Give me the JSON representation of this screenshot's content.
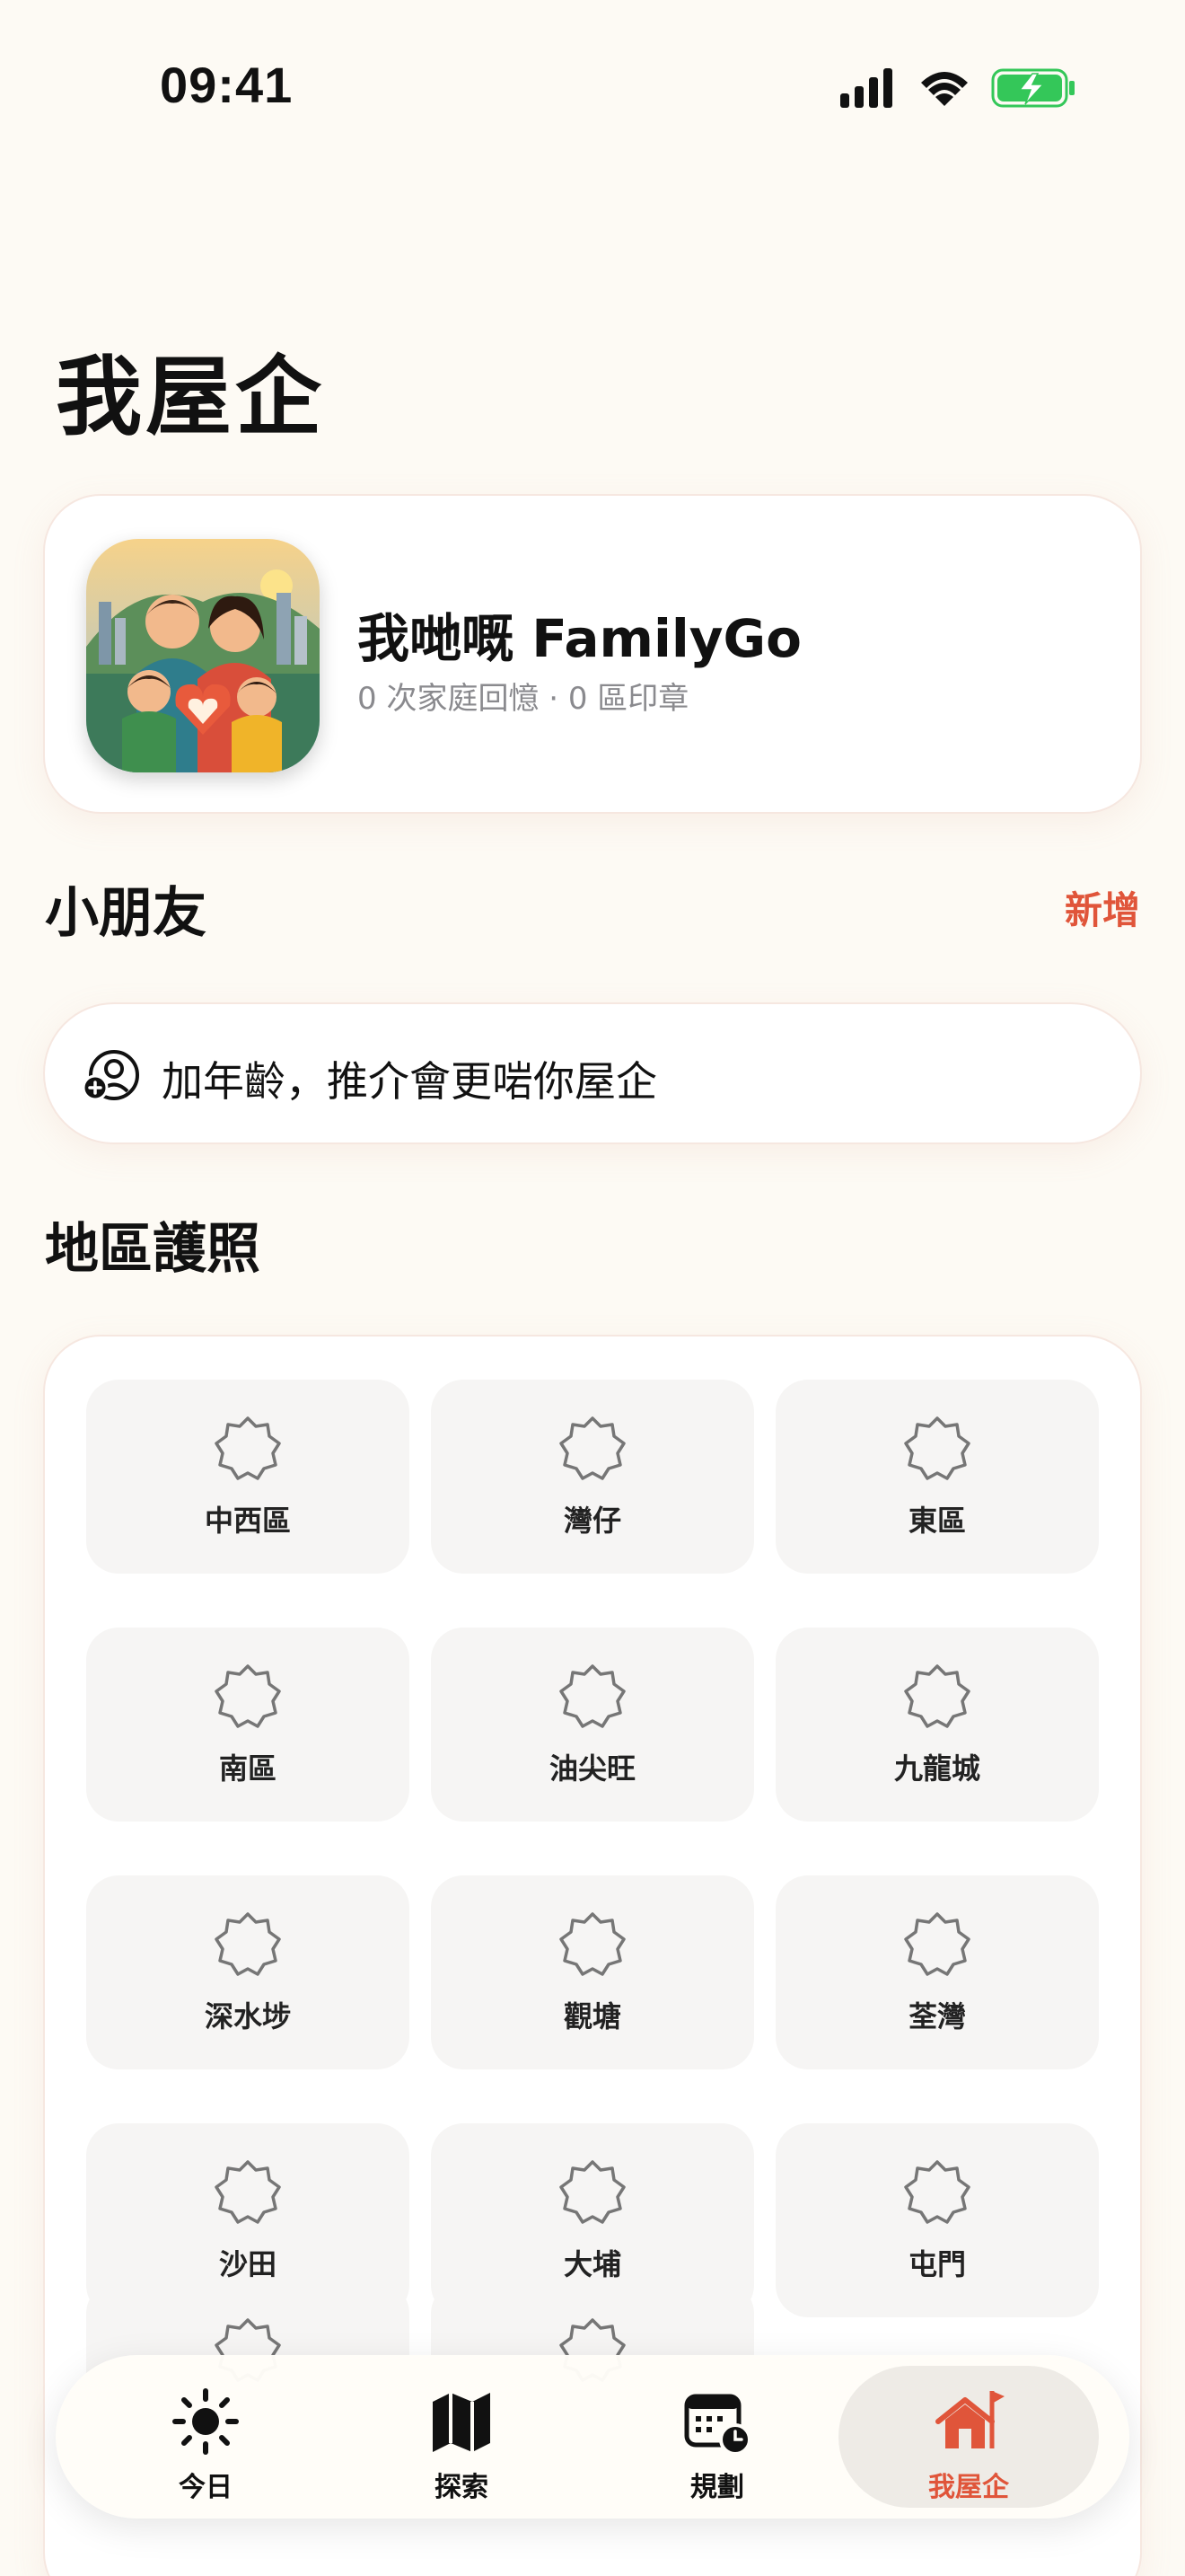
{
  "status_bar": {
    "time": "09:41",
    "icons": [
      "cellular-icon",
      "wifi-icon",
      "battery-charging-icon"
    ],
    "battery_color": "#34C759"
  },
  "page": {
    "title": "我屋企"
  },
  "profile": {
    "name": "我哋嘅 FamilyGo",
    "stats": "0 次家庭回憶 · 0 區印章",
    "logo_icon": "family-app-logo"
  },
  "kids": {
    "title": "小朋友",
    "add_label": "新增",
    "hint": "加年齡，推介會更啱你屋企",
    "hint_icon": "add-person-icon"
  },
  "passport": {
    "title": "地區護照",
    "districts": [
      {
        "label": "中西區"
      },
      {
        "label": "灣仔"
      },
      {
        "label": "東區"
      },
      {
        "label": "南區"
      },
      {
        "label": "油尖旺"
      },
      {
        "label": "九龍城"
      },
      {
        "label": "深水埗"
      },
      {
        "label": "觀塘"
      },
      {
        "label": "荃灣"
      },
      {
        "label": "沙田"
      },
      {
        "label": "大埔"
      },
      {
        "label": "屯門"
      }
    ]
  },
  "tab_bar": {
    "tabs": [
      {
        "label": "今日",
        "icon": "sun-icon",
        "active": false
      },
      {
        "label": "探索",
        "icon": "map-icon",
        "active": false
      },
      {
        "label": "規劃",
        "icon": "calendar-clock-icon",
        "active": false
      },
      {
        "label": "我屋企",
        "icon": "home-flag-icon",
        "active": true
      }
    ]
  },
  "colors": {
    "background": "#FDFAF4",
    "accent": "#E0553A",
    "secondary_text": "#8A8A8E",
    "stamp_tile": "#F6F5F4"
  }
}
